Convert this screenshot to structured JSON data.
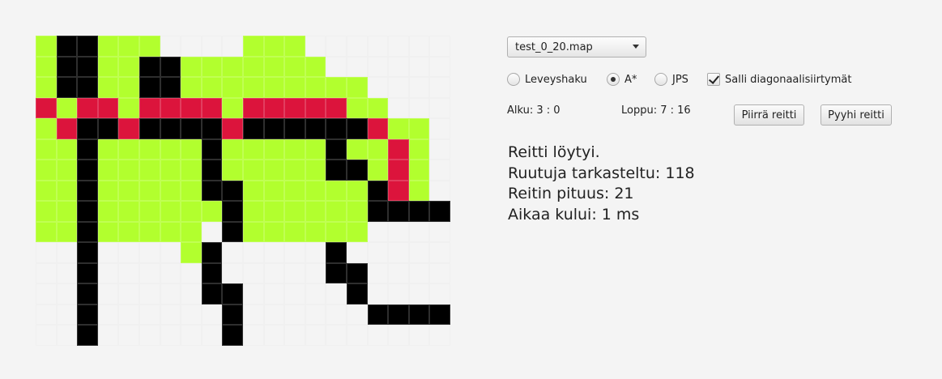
{
  "map_select": {
    "value": "test_0_20.map",
    "icon": "chevron-down-icon"
  },
  "algorithms": [
    {
      "label": "Leveyshaku",
      "selected": false
    },
    {
      "label": "A*",
      "selected": true
    },
    {
      "label": "JPS",
      "selected": false
    }
  ],
  "diagonal": {
    "label": "Salli diagonaalisiirtymät",
    "checked": true
  },
  "start_label": "Alku: 3 : 0",
  "end_label": "Loppu: 7 : 16",
  "buttons": {
    "draw": "Piirrä reitti",
    "clear": "Pyyhi reitti"
  },
  "results": [
    "Reitti löytyi.",
    "Ruutuja tarkasteltu: 118",
    "Reitin pituus: 21",
    "Aikaa kului: 1 ms"
  ],
  "colors": {
    "visited": "#b2ff2e",
    "path": "#dc143c",
    "wall": "#000000",
    "empty": "#f4f4f4"
  },
  "map": {
    "legend": {
      ".": "empty",
      "g": "visited",
      "r": "path",
      "#": "wall"
    },
    "rows": [
      "g##ggg....ggg.......",
      "g##gg##ggggggg......",
      "g##gg##ggggggggg....",
      "rgrrgrrrrgrrrrrgg...",
      "gr##r####r######rgg.",
      "gg#ggggg#ggggg#ggrg.",
      "gg#ggggg#ggggg##grg.",
      "gg#ggggg##gggggg#rg.",
      "gg#gggggg#gggggg####",
      "gg#ggggg.#gggggg....",
      "..#....g#.....#.....",
      "..#.....#.....##....",
      "..#.....##.....#....",
      "..#......#......####",
      "..#......#.........."
    ]
  }
}
